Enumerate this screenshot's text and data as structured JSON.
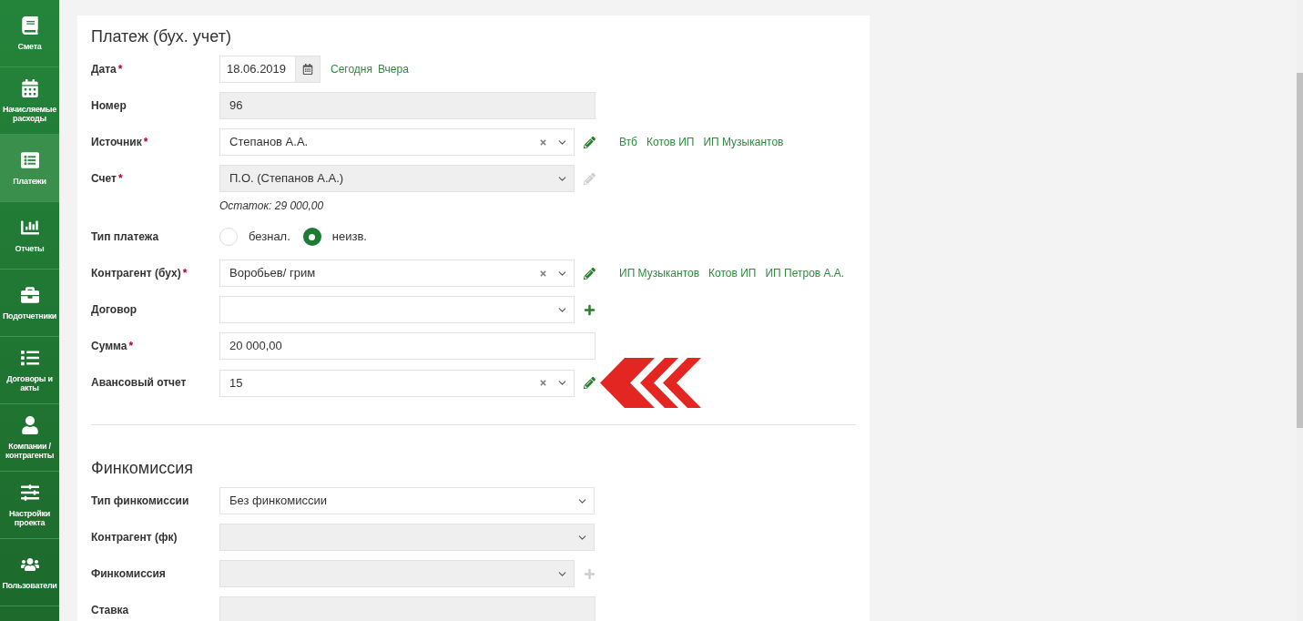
{
  "sidebar": {
    "items": [
      {
        "label": "Смета",
        "selected": false
      },
      {
        "label": "Начисляемые расходы",
        "selected": false
      },
      {
        "label": "Платежи",
        "selected": true
      },
      {
        "label": "Отчеты",
        "selected": false
      },
      {
        "label": "Подотчетники",
        "selected": false
      },
      {
        "label": "Договоры и акты",
        "selected": false
      },
      {
        "label": "Компании / контрагенты",
        "selected": false
      },
      {
        "label": "Настройки проекта",
        "selected": false
      },
      {
        "label": "Пользователи",
        "selected": false
      }
    ]
  },
  "sections": [
    {
      "title": "Платеж (бух. учет)",
      "divider": true,
      "fields": [
        {
          "kind": "date",
          "label": "Дата",
          "required_mark": "*",
          "value": "18.06.2019",
          "links": [
            "Сегодня",
            "Вчера"
          ]
        },
        {
          "kind": "text",
          "label": "Номер",
          "value": "96",
          "disabled": true
        },
        {
          "kind": "select",
          "label": "Источник",
          "required_mark": "*",
          "value": "Степанов А.А.",
          "clearable": true,
          "disabled": false,
          "edit": true,
          "action_disabled": false,
          "links": [
            "Втб",
            "Котов ИП",
            "ИП Музыкантов"
          ]
        },
        {
          "kind": "select",
          "label": "Счет",
          "required_mark": "*",
          "value": "П.О. (Степанов А.А.)",
          "clearable": false,
          "disabled": true,
          "edit": true,
          "action_disabled": true,
          "note": "Остаток: 29 000,00"
        },
        {
          "kind": "radio",
          "label": "Тип платежа",
          "options": [
            {
              "label": "безнал.",
              "selected": false
            },
            {
              "label": "неизв.",
              "selected": true
            }
          ]
        },
        {
          "kind": "select",
          "label": "Контрагент (бух)",
          "required_mark": "*",
          "value": "Воробьев/ грим",
          "clearable": true,
          "disabled": false,
          "edit": true,
          "action_disabled": false,
          "links": [
            "ИП Музыкантов",
            "Котов ИП",
            "ИП Петров А.А."
          ]
        },
        {
          "kind": "select",
          "label": "Договор",
          "clearable": false,
          "disabled": false,
          "add": true,
          "action_disabled": false
        },
        {
          "kind": "text",
          "label": "Сумма",
          "required_mark": "*",
          "value": "20 000,00",
          "disabled": false
        },
        {
          "kind": "select",
          "label": "Авансовый отчет",
          "value": "15",
          "clearable": true,
          "disabled": false,
          "edit": true,
          "action_disabled": false,
          "pointer": true
        }
      ]
    },
    {
      "title": "Финкомиссия",
      "fields": [
        {
          "kind": "select",
          "label": "Тип финкомиссии",
          "value": "Без финкомиссии",
          "clearable": false,
          "disabled": false,
          "wide": true
        },
        {
          "kind": "select",
          "label": "Контрагент (фк)",
          "clearable": false,
          "disabled": true,
          "wide": true
        },
        {
          "kind": "select",
          "label": "Финкомиссия",
          "clearable": false,
          "disabled": true,
          "add": true,
          "action_disabled": true
        },
        {
          "kind": "text",
          "label": "Ставка",
          "disabled": true
        }
      ]
    }
  ]
}
